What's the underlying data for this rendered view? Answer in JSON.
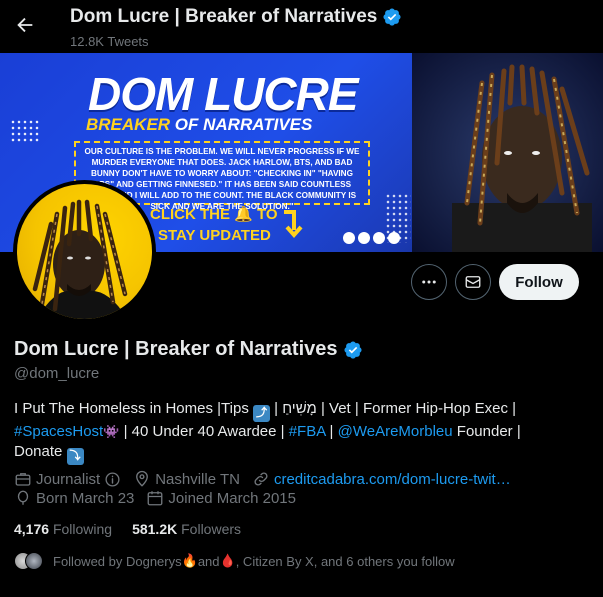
{
  "header": {
    "name": "Dom Lucre | Breaker of Narratives",
    "tweets": "12.8K Tweets"
  },
  "banner": {
    "title": "DOM LUCRE",
    "subtitle_part1": "BREAKER",
    "subtitle_part2": " OF NARRATIVES",
    "body_text": "OUR CULTURE IS THE PROBLEM. WE WILL NEVER PROGRESS IF WE MURDER EVERYONE THAT DOES. JACK HARLOW, BTS, AND BAD BUNNY DON'T HAVE TO WORRY ABOUT: \"CHECKING IN\" \"HAVING OPS\" AND GETTING FINNESED.\" IT HAS BEEN SAID COUNTLESS TIMES AND I WILL ADD TO THE COUNT. THE BLACK COMMUNITY IS SICK AND WE ARE THE SOLUTION.\"",
    "cta_line1": "CLICK THE 🔔 TO",
    "cta_line2": "STAY UPDATED"
  },
  "actions": {
    "follow_label": "Follow"
  },
  "profile": {
    "name": "Dom Lucre | Breaker of Narratives",
    "handle": "@dom_lucre",
    "bio": {
      "line1_pre": "I Put The Homeless in Homes |Tips ",
      "line1_emoji": "⤴",
      "line1_post": " | מָשִׁיחַ | Vet | Former Hip-Hop Exec |",
      "spaces_link": "#SpacesHost",
      "sparkle": "👾",
      "mid": " | 40 Under 40 Awardee | ",
      "fba_link": "#FBA",
      "sep": " | ",
      "morbleu_link": "@WeAreMorbleu",
      "founder": " Founder |",
      "donate": "Donate ",
      "donate_emoji": "⤵"
    },
    "category": "Journalist",
    "location": "Nashville TN",
    "website": "creditcadabra.com/dom-lucre-twit…",
    "born": "Born March 23",
    "joined": "Joined March 2015",
    "following_count": "4,176",
    "following_label": "Following",
    "followers_count": "581.2K",
    "followers_label": "Followers",
    "followed_by_pre": "Followed by Dognerys ",
    "followed_by_fire": "🔥",
    "followed_by_and": "and",
    "followed_by_drop": "🩸",
    "followed_by_post": ", Citizen By X, and 6 others you follow"
  },
  "colors": {
    "accent": "#1d9bf0",
    "verified": "#1d9bf0",
    "banner_yellow": "#ffd21f",
    "banner_blue": "#1f4ee8"
  }
}
